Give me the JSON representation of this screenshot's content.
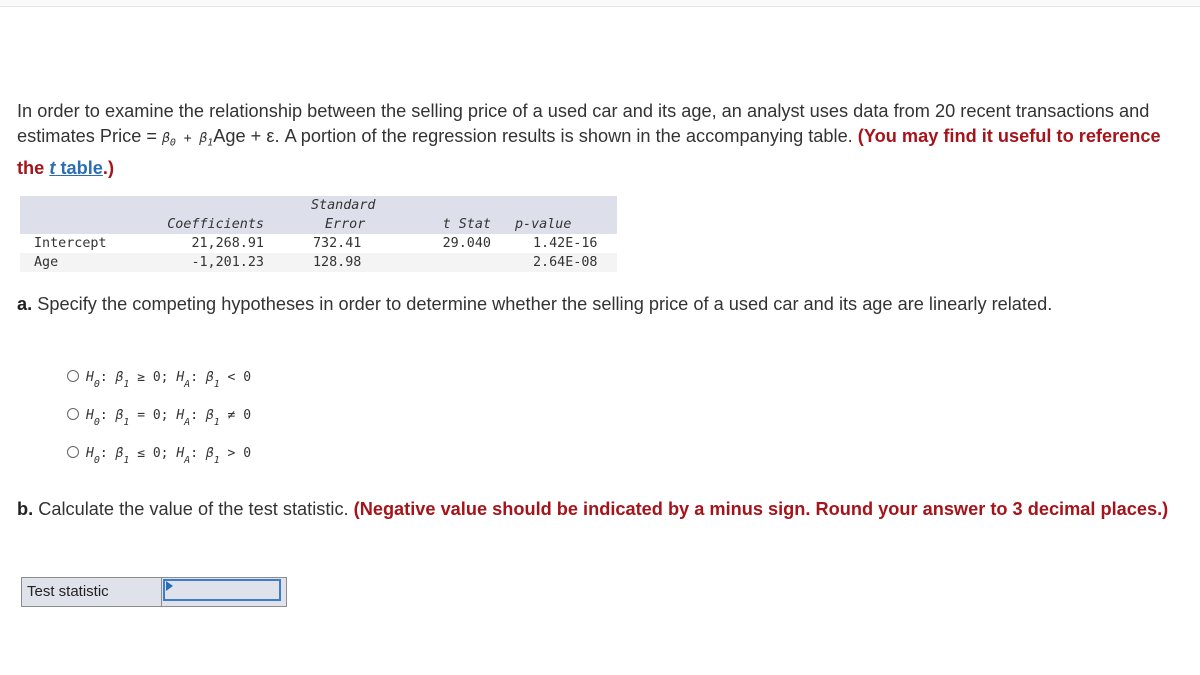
{
  "intro": {
    "text_1": "In order to examine the relationship between the selling price of a used car and its age, an analyst uses data from 20 recent transactions and estimates Price = ",
    "beta0": "β",
    "beta0_sub": "0",
    "plus": " + ",
    "beta1": "β",
    "beta1_sub": "1",
    "text_2": "Age + ε. A portion of the regression results is shown in the accompanying table. ",
    "note_prefix": "(You may find it useful to reference the ",
    "link_t": "t",
    "link_rest": " table",
    "note_suffix": ".)"
  },
  "regression_table": {
    "headers": [
      "",
      "Coefficients",
      "Standard Error",
      "t Stat",
      "p-value"
    ],
    "header_se_line1": "Standard",
    "header_se_line2": "Error",
    "rows": [
      {
        "label": "Intercept",
        "coefficient": "21,268.91",
        "std_error": "732.41",
        "t_stat": "29.040",
        "p_value": "1.42E-16"
      },
      {
        "label": "Age",
        "coefficient": "-1,201.23",
        "std_error": "128.98",
        "t_stat": "",
        "p_value": "2.64E-08"
      }
    ]
  },
  "part_a": {
    "label": "a.",
    "text": " Specify the competing hypotheses in order to determine whether the selling price of a used car and its age are linearly related.",
    "options": [
      {
        "h0": "H",
        "h0_sub": "0",
        "b": "β",
        "b_sub": "1",
        "h0_rel": " ≥ 0; ",
        "ha": "H",
        "ha_sub": "A",
        "ha_rel": " < 0",
        "selected": false
      },
      {
        "h0": "H",
        "h0_sub": "0",
        "b": "β",
        "b_sub": "1",
        "h0_rel": " = 0; ",
        "ha": "H",
        "ha_sub": "A",
        "ha_rel": " ≠ 0",
        "selected": false
      },
      {
        "h0": "H",
        "h0_sub": "0",
        "b": "β",
        "b_sub": "1",
        "h0_rel": " ≤ 0; ",
        "ha": "H",
        "ha_sub": "A",
        "ha_rel": " > 0",
        "selected": false
      }
    ]
  },
  "part_b": {
    "label": "b.",
    "text": " Calculate the value of the test statistic. ",
    "note": "(Negative value should be indicated by a minus sign. Round your answer to 3 decimal places.)",
    "input_label": "Test statistic",
    "input_value": ""
  }
}
